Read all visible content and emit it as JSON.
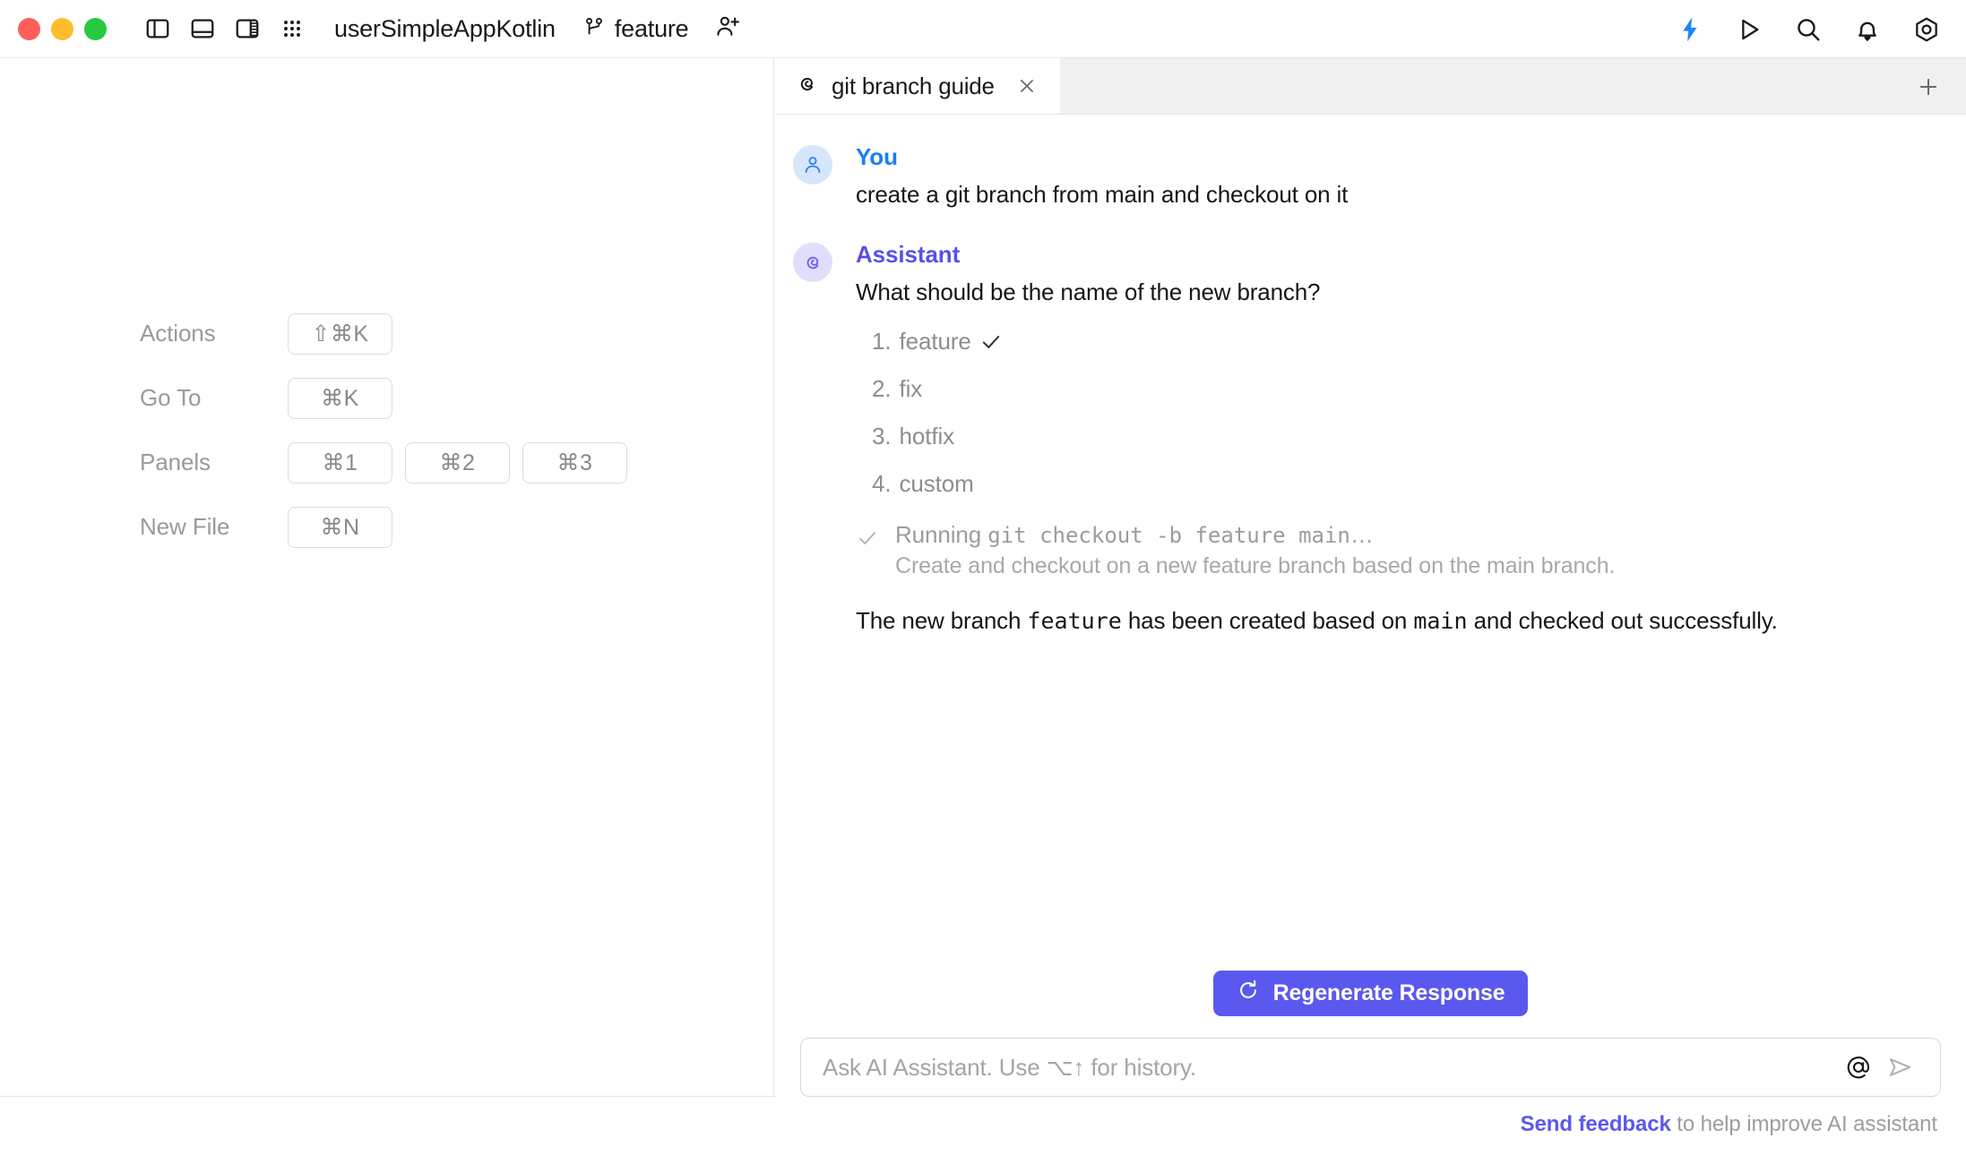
{
  "window": {
    "project_title": "userSimpleAppKotlin",
    "branch": "feature",
    "traffic_lights": [
      "close-red",
      "minimize-yellow",
      "zoom-green"
    ],
    "left_icons": [
      "left-panel-icon",
      "bottom-panel-icon",
      "right-panel-icon",
      "grid-dots-icon"
    ],
    "right_icons": [
      "lightning-icon",
      "run-icon",
      "search-icon",
      "notifications-bell-icon",
      "settings-gear-icon"
    ],
    "accent_blue": "#1a7ef0",
    "accent_purple": "#5b58ef"
  },
  "tabbar": {
    "active_tab": {
      "icon": "ai-spiral-icon",
      "label": "git branch guide",
      "close": "×"
    },
    "new_tab_label": "+"
  },
  "shortcuts": {
    "rows": [
      {
        "label": "Actions",
        "keys": [
          "⇧⌘K"
        ]
      },
      {
        "label": "Go To",
        "keys": [
          "⌘K"
        ]
      },
      {
        "label": "Panels",
        "keys": [
          "⌘1",
          "⌘2",
          "⌘3"
        ]
      },
      {
        "label": "New File",
        "keys": [
          "⌘N"
        ]
      }
    ]
  },
  "chat": {
    "messages": [
      {
        "author": "You",
        "avatar": "user-avatar-icon",
        "text": "create a git branch from main and checkout on it"
      },
      {
        "author": "Assistant",
        "avatar": "ai-spiral-avatar-icon",
        "text": "What should be the name of the new branch?"
      }
    ],
    "options": [
      {
        "num": "1.",
        "label": "feature",
        "selected": true
      },
      {
        "num": "2.",
        "label": "fix",
        "selected": false
      },
      {
        "num": "3.",
        "label": "hotfix",
        "selected": false
      },
      {
        "num": "4.",
        "label": "custom",
        "selected": false
      }
    ],
    "tool_call": {
      "status_icon": "checkmark-icon",
      "prefix": "Running ",
      "command": "git checkout -b feature main",
      "suffix": "…",
      "description": "Create and checkout on a new feature branch based on the main branch."
    },
    "final": {
      "part1": "The new branch ",
      "code1": "feature",
      "part2": " has been created based on ",
      "code2": "main",
      "part3": " and checked out successfully."
    }
  },
  "footer": {
    "regenerate_label": "Regenerate Response",
    "regenerate_icon": "refresh-icon",
    "input_placeholder": "Ask AI Assistant. Use ⌥↑ for history.",
    "input_value": "",
    "mention_icon": "at-mention-icon",
    "send_icon": "send-arrow-icon",
    "feedback_link": "Send feedback",
    "feedback_rest": " to help improve AI assistant"
  }
}
